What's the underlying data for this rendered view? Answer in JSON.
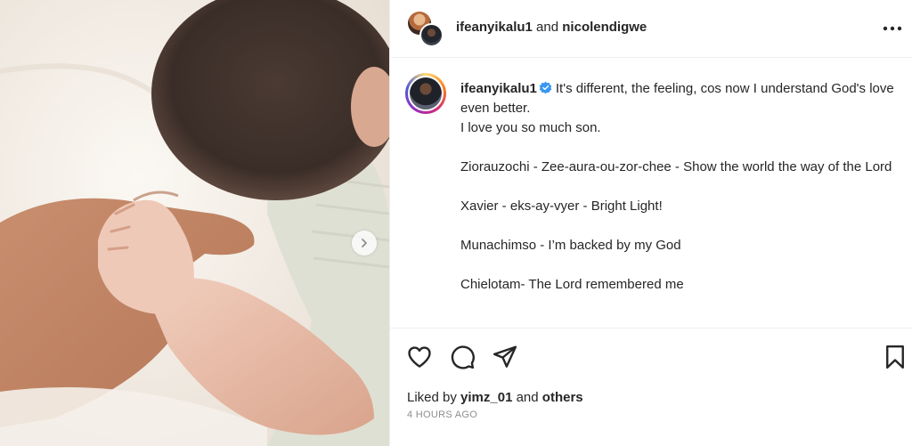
{
  "post": {
    "photo": {
      "description_icon": "carousel-next-icon"
    },
    "header": {
      "author": "ifeanyikalu1",
      "joiner": " and ",
      "coauthor": "nicolendigwe"
    },
    "caption": {
      "username": "ifeanyikalu1",
      "lines": [
        "It's different, the feeling, cos now I understand God's love even better.",
        "I love you so much son.",
        "Ziorauzochi - Zee-aura-ou-zor-chee - Show the world the way of the Lord",
        "Xavier - eks-ay-vyer - Bright Light!",
        "Munachimso - I’m backed by my God",
        "Chielotam- The Lord remembered me"
      ]
    },
    "actions": {
      "liked_prefix": "Liked by ",
      "liked_user": "yimz_01",
      "liked_joiner": " and ",
      "liked_others": "others",
      "timestamp": "4 HOURS AGO"
    }
  },
  "colors": {
    "verified": "#3897f0",
    "text": "#262626",
    "muted": "#8e8e8e"
  }
}
